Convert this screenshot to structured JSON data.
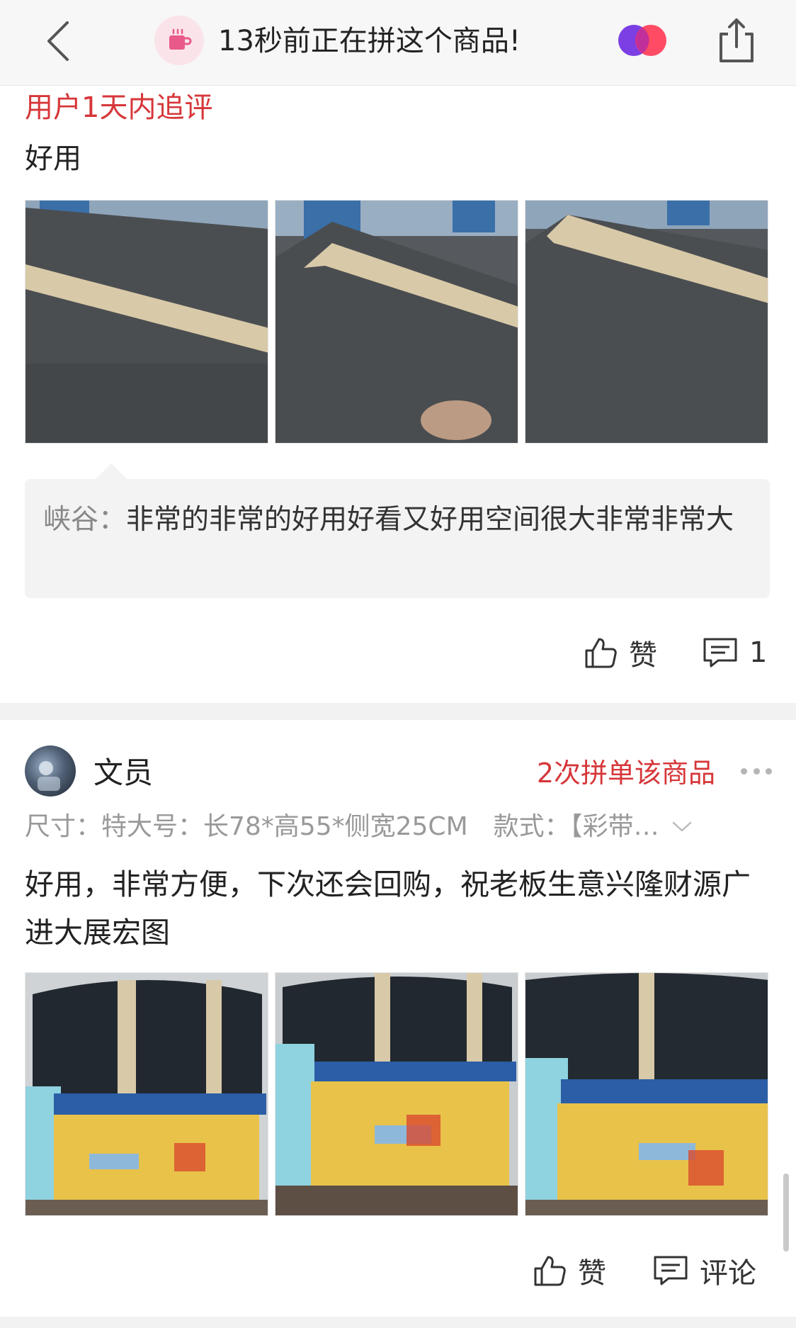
{
  "header": {
    "back_icon": "chevron-left-icon",
    "avatar_icon": "coffee-cup-icon",
    "pin_text": "13秒前正在拼这个商品!",
    "logo_icon": "brand-logo-icon",
    "share_icon": "share-icon",
    "colors": {
      "logo_left": "#7b3fe4",
      "logo_right": "#ff3d57"
    }
  },
  "review1": {
    "followup_title": "用户1天内追评",
    "followup_text": "好用",
    "photos": [
      "photo-black-bag-1",
      "photo-black-bag-2",
      "photo-black-bag-3"
    ],
    "reply": {
      "name": "峡谷：",
      "text": "非常的非常的好用好看又好用空间很大非常非常大"
    },
    "like_label": "赞",
    "comment_count": "1"
  },
  "review2": {
    "username": "文员",
    "group_count": "2次拼单该商品",
    "spec": "尺寸：特大号：长78*高55*侧宽25CM　款式：【彩带…",
    "text": "好用，非常方便，下次还会回购，祝老板生意兴隆财源广进大展宏图",
    "photos": [
      "photo-bag-with-paper-cutter-1",
      "photo-bag-with-paper-cutter-2",
      "photo-bag-with-paper-cutter-3"
    ],
    "like_label": "赞",
    "comment_label": "评论"
  },
  "colors": {
    "accent_red": "#d6373a",
    "reply_bg": "#f3f3f3"
  }
}
